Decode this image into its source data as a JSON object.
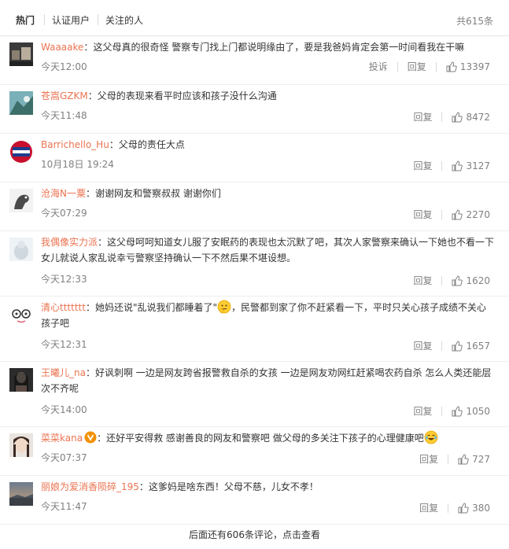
{
  "tabs": {
    "hot": "热门",
    "verified": "认证用户",
    "following": "关注的人"
  },
  "total": "共615条",
  "actions": {
    "report": "投诉",
    "reply": "回复"
  },
  "comments": [
    {
      "user": "Waaaake",
      "sep": "：",
      "text": "这父母真的很奇怪 警察专门找上门都说明缘由了，要是我爸妈肯定会第一时间看我在干嘛",
      "time": "今天12:00",
      "likes": "13397"
    },
    {
      "user": "苍嵩GZKM",
      "sep": "：",
      "text": "父母的表现来看平时应该和孩子没什么沟通",
      "time": "今天11:48",
      "likes": "8472"
    },
    {
      "user": "Barrichello_Hu",
      "sep": "：",
      "text": "父母的责任大点",
      "time": "10月18日 19:24",
      "likes": "3127"
    },
    {
      "user": "沧海N一粟",
      "sep": "：",
      "text": "谢谢网友和警察叔叔 谢谢你们",
      "time": "今天07:29",
      "likes": "2270"
    },
    {
      "user": "我偶像实力派",
      "sep": "：",
      "text": "这父母呵呵知道女儿服了安眠药的表现也太沉默了吧，其次人家警察来确认一下她也不看一下女儿就说人家乱说幸亏警察坚持确认一下不然后果不堪设想。",
      "time": "今天12:33",
      "likes": "1620"
    },
    {
      "user": "清心ttttttt",
      "sep": "：",
      "text_a": "她妈还说\"乱说我们都睡着了\"",
      "text_b": "，民警都到家了你不赶紧看一下，平时只关心孩子成绩不关心孩子吧",
      "time": "今天12:31",
      "likes": "1657"
    },
    {
      "user": "王曦儿_na",
      "sep": "：",
      "text": "好讽刺啊 一边是网友跨省报警救自杀的女孩 一边是网友劝网红赶紧喝农药自杀 怎么人类还能层次不齐呢",
      "time": "今天14:00",
      "likes": "1050"
    },
    {
      "user": "菜菜kana",
      "sep": "：",
      "text": "还好平安得救 感谢善良的网友和警察吧 做父母的多关注下孩子的心理健康吧",
      "time": "今天07:37",
      "likes": "727"
    },
    {
      "user": "丽娘为爱消香陨碎_195",
      "sep": "：",
      "text": "这爹妈是啥东西！父母不慈，儿女不孝！",
      "time": "今天11:47",
      "likes": "380"
    }
  ],
  "more": "后面还有606条评论，点击查看",
  "colors": {
    "username": "#eb7350",
    "muted": "#808080",
    "text": "#333333"
  }
}
